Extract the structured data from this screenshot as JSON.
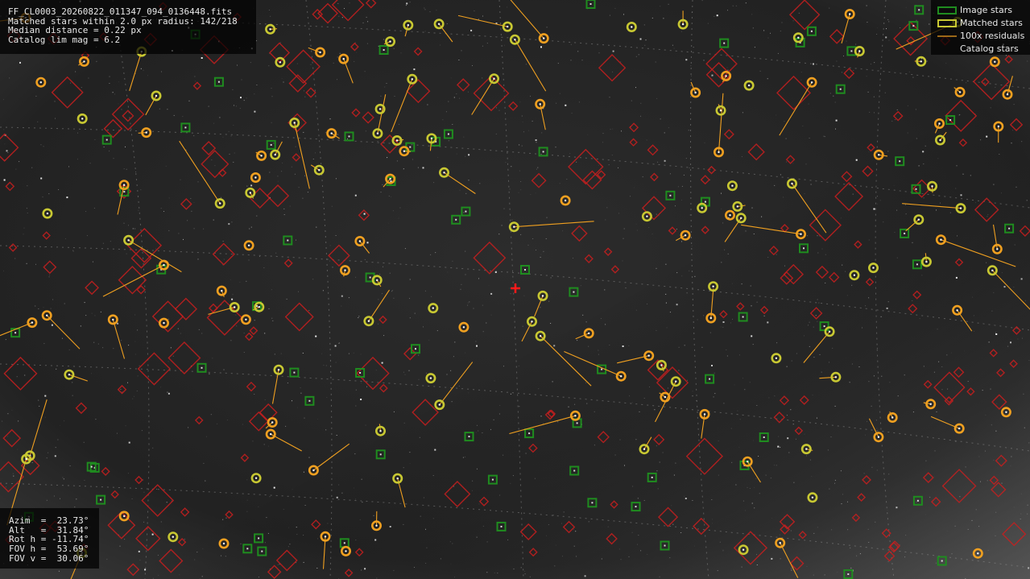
{
  "window": {
    "file_name": "FF_CL0003_20260822_011347_094_0136448.fits",
    "matched_stars_line": "Matched stars within 2.0 px radius: 142/218",
    "median_distance_line": "Median distance = 0.22 px",
    "catalog_lim_mag_line": "Catalog lim mag = 6.2"
  },
  "legend": {
    "items": [
      {
        "label": "Image stars",
        "icon": "green-square-icon",
        "color": "#1f8c1f"
      },
      {
        "label": "Matched stars",
        "icon": "yellow-circle-icon",
        "color": "#c8c832"
      },
      {
        "label": "100x residuals",
        "icon": "orange-line-icon",
        "color": "#f0a020"
      },
      {
        "label": "Catalog stars",
        "icon": "red-diamond-icon",
        "color": "#c81e1e"
      }
    ]
  },
  "pointing": {
    "azim": "Azim  =  23.73°",
    "alt": "Alt   =  31.84°",
    "rot": "Rot h = -11.74°",
    "fov_h": "FOV h =  53.69°",
    "fov_v": "FOV v =  30.06°"
  },
  "colors": {
    "image_star": "#1f8c1f",
    "matched_star": "#c8c832",
    "residual": "#f0a020",
    "catalog_star": "#c81e1e",
    "center_marker": "#ff1a1a",
    "grid": "#9a9a9a"
  },
  "center_marker": {
    "icon": "red-cross-icon"
  }
}
